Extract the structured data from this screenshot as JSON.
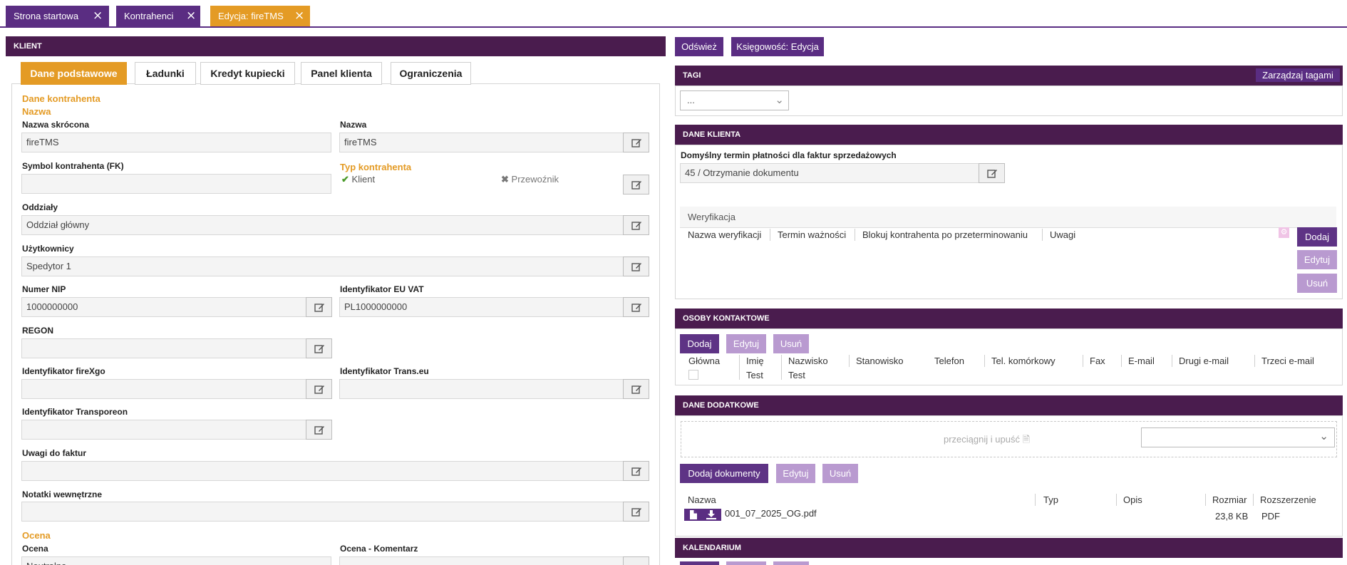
{
  "top_tabs": [
    {
      "label": "Strona startowa"
    },
    {
      "label": "Kontrahenci"
    },
    {
      "label": "Edycja: fireTMS"
    }
  ],
  "left": {
    "header": "KLIENT",
    "tabs": [
      {
        "label": "Dane podstawowe"
      },
      {
        "label": "Ładunki"
      },
      {
        "label": "Kredyt kupiecki"
      },
      {
        "label": "Panel klienta"
      },
      {
        "label": "Ograniczenia"
      }
    ],
    "section_dane": "Dane kontrahenta",
    "section_nazwa": "Nazwa",
    "nazwa_skrocona_label": "Nazwa skrócona",
    "nazwa_skrocona_value": "fireTMS",
    "nazwa_label": "Nazwa",
    "nazwa_value": "fireTMS",
    "symbol_label": "Symbol kontrahenta (FK)",
    "symbol_value": "",
    "typ_label": "Typ kontrahenta",
    "typ_klient": "Klient",
    "typ_przewoznik": "Przewoźnik",
    "oddzialy_label": "Oddziały",
    "oddzialy_value": "Oddział główny",
    "uzytkownicy_label": "Użytkownicy",
    "uzytkownicy_value": "Spedytor 1",
    "nip_label": "Numer NIP",
    "nip_value": "1000000000",
    "euvat_label": "Identyfikator EU VAT",
    "euvat_value": "PL1000000000",
    "regon_label": "REGON",
    "regon_value": "",
    "firexgo_label": "Identyfikator fireXgo",
    "transeu_label": "Identyfikator Trans.eu",
    "transporeon_label": "Identyfikator Transporeon",
    "uwagi_label": "Uwagi do faktur",
    "notatki_label": "Notatki wewnętrzne",
    "section_ocena": "Ocena",
    "ocena_label": "Ocena",
    "ocena_value": "Neutralna",
    "ocena_kom_label": "Ocena - Komentarz"
  },
  "right": {
    "btn_odswiez": "Odśwież",
    "btn_ksiegowosc": "Księgowość: Edycja",
    "tagi_header": "TAGI",
    "tagi_manage": "Zarządzaj tagami",
    "tagi_select": "...",
    "dane_klienta_header": "DANE KLIENTA",
    "termin_label": "Domyślny termin płatności dla faktur sprzedażowych",
    "termin_value": "45 / Otrzymanie dokumentu",
    "weryfikacja_title": "Weryfikacja",
    "weryfikacja_cols": [
      "Nazwa weryfikacji",
      "Termin ważności",
      "Blokuj kontrahenta po przeterminowaniu",
      "Uwagi"
    ],
    "wer_dodaj": "Dodaj",
    "wer_edytuj": "Edytuj",
    "wer_usun": "Usuń",
    "osoby_header": "OSOBY KONTAKTOWE",
    "osoby_dodaj": "Dodaj",
    "osoby_edytuj": "Edytuj",
    "osoby_usun": "Usuń",
    "osoby_cols": [
      "Główna",
      "Imię",
      "Nazwisko",
      "Stanowisko",
      "Telefon",
      "Tel. komórkowy",
      "Fax",
      "E-mail",
      "Drugi e-mail",
      "Trzeci e-mail"
    ],
    "osoby_row": {
      "imie": "Test",
      "nazwisko": "Test"
    },
    "dodatkowe_header": "DANE DODATKOWE",
    "drop_text": "przeciągnij i upuść",
    "dok_dodaj": "Dodaj dokumenty",
    "dok_edytuj": "Edytuj",
    "dok_usun": "Usuń",
    "dok_cols": [
      "Nazwa",
      "Typ",
      "Opis",
      "Rozmiar",
      "Rozszerzenie"
    ],
    "dok_row": {
      "nazwa": "001_07_2025_OG.pdf",
      "rozmiar": "23,8 KB",
      "rozszerzenie": "PDF"
    },
    "kalendarium_header": "KALENDARIUM"
  },
  "colors": {
    "purple": "#5a2d82",
    "dark_purple": "#4a1c4e",
    "orange": "#e49b25",
    "light_purple": "#b99ad0"
  }
}
